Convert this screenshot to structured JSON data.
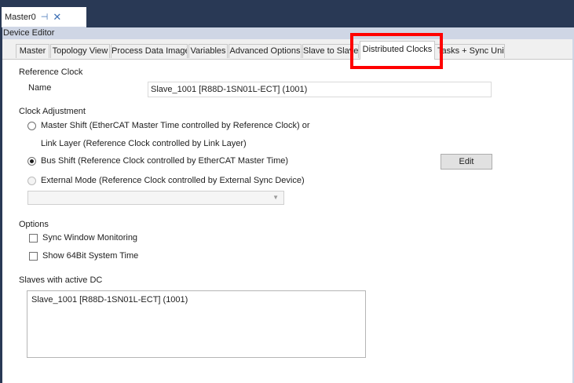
{
  "document_tab": {
    "title": "Master0",
    "pin_icon": "pin-icon",
    "close_icon": "close-icon"
  },
  "panel": {
    "title": "Device Editor"
  },
  "tabs": [
    {
      "label": "Master"
    },
    {
      "label": "Topology View"
    },
    {
      "label": "Process Data Image"
    },
    {
      "label": "Variables"
    },
    {
      "label": "Advanced Options"
    },
    {
      "label": "Slave to Slave"
    },
    {
      "label": "Distributed Clocks",
      "active": true
    },
    {
      "label": "Tasks + Sync Units"
    }
  ],
  "reference_clock": {
    "heading": "Reference Clock",
    "name_label": "Name",
    "name_value": "Slave_1001 [R88D-1SN01L-ECT] (1001)"
  },
  "clock_adjustment": {
    "heading": "Clock Adjustment",
    "master_shift": "Master Shift (EtherCAT Master Time controlled by Reference Clock) or",
    "link_layer": "Link Layer (Reference Clock controlled by Link Layer)",
    "bus_shift": "Bus Shift (Reference Clock controlled by EtherCAT Master Time)",
    "external_mode": "External Mode (Reference Clock controlled by External Sync Device)",
    "edit_button": "Edit",
    "selected": "bus_shift",
    "external_select_value": ""
  },
  "options": {
    "heading": "Options",
    "sync_window": "Sync Window Monitoring",
    "show_64bit": "Show 64Bit System Time",
    "sync_window_checked": false,
    "show_64bit_checked": false
  },
  "slaves": {
    "heading": "Slaves with active DC",
    "items": [
      "Slave_1001 [R88D-1SN01L-ECT] (1001)"
    ]
  },
  "colors": {
    "highlight": "#ff0000",
    "chrome": "#293955",
    "panel_header": "#cfd6e5"
  }
}
